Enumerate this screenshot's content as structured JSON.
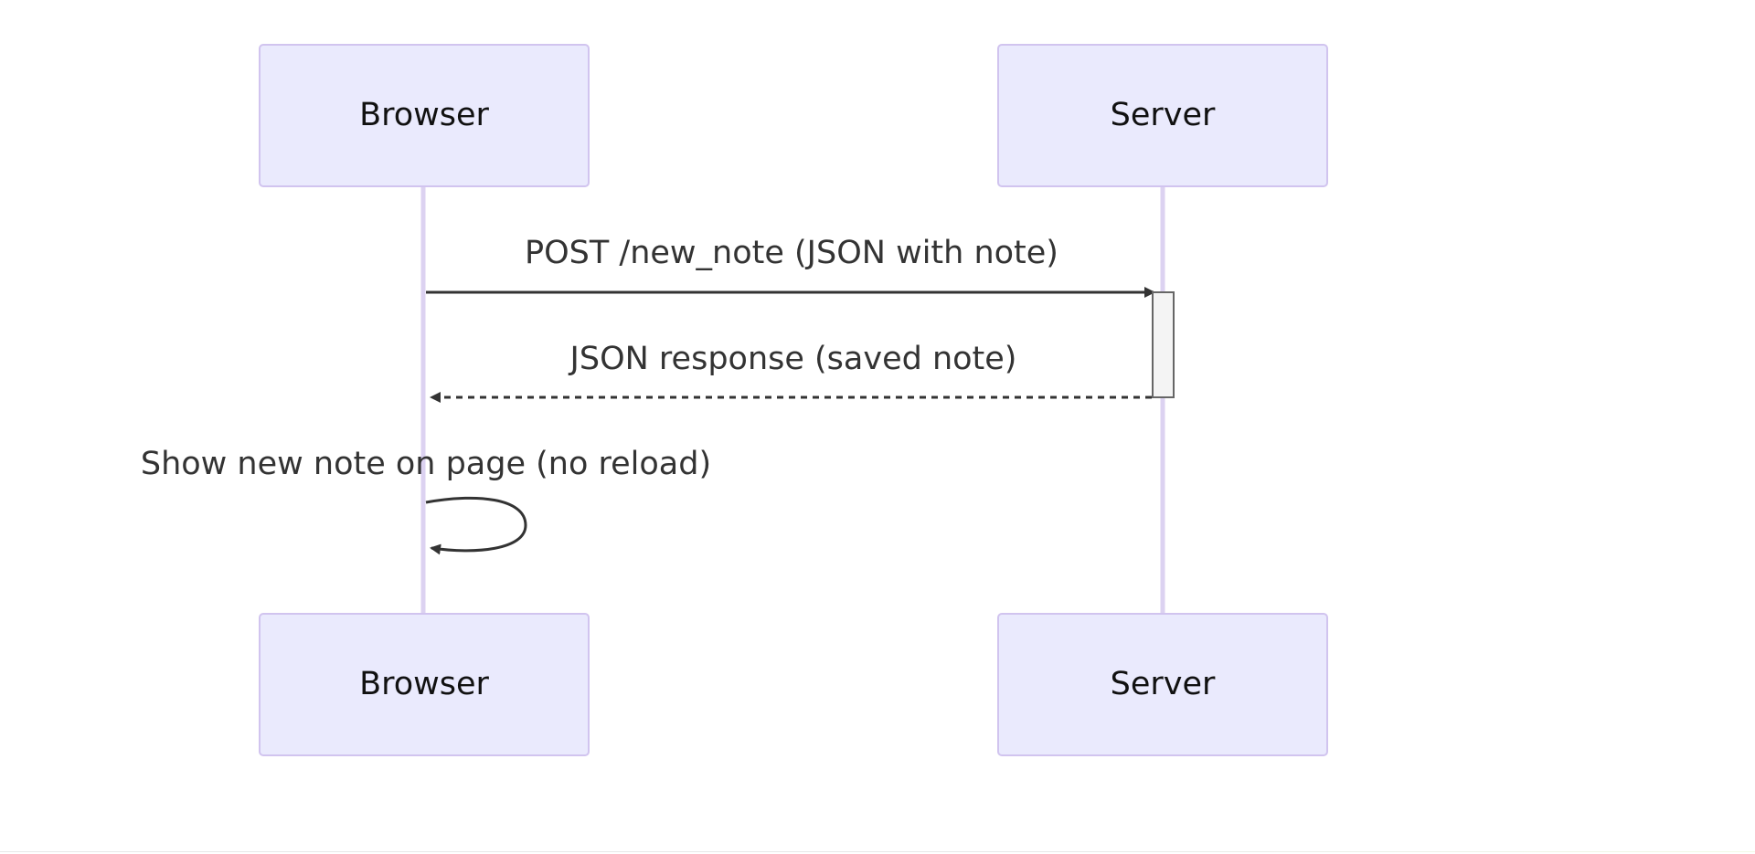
{
  "actors": {
    "browser": {
      "label": "Browser"
    },
    "server": {
      "label": "Server"
    }
  },
  "messages": [
    {
      "from": "Browser",
      "to": "Server",
      "style": "solid",
      "text": "POST /new_note (JSON with note)"
    },
    {
      "from": "Server",
      "to": "Browser",
      "style": "dashed",
      "text": "JSON response (saved note)"
    },
    {
      "from": "Browser",
      "to": "Browser",
      "style": "solid",
      "text": "Show new note on page (no reload)"
    }
  ],
  "colors": {
    "actor_fill": "#eaeafd",
    "actor_stroke": "#d1c4ef",
    "lifeline": "#dcd2f1",
    "message": "#333333",
    "activation_fill": "#f4f4f4"
  }
}
